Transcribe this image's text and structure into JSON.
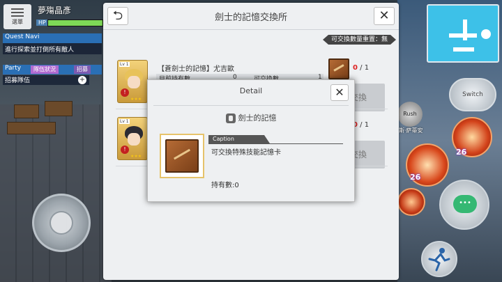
{
  "hud": {
    "menu_label": "選單",
    "player_name": "夢殤晶彥",
    "hp_label": "HP",
    "hp_fraction": 1.0,
    "quest_navi_label": "Quest Navi",
    "quest_text": "進行探索並打倒所有敵人",
    "party_label": "Party",
    "party_tab_1": "隊伍狀況",
    "party_tab_2": "招募",
    "party_row": "招募隊伍",
    "party_add": "+"
  },
  "panel": {
    "title": "劍士的記憶交換所",
    "back": "⮌",
    "close": "✕",
    "reset_badge": "可交換數量重置：無",
    "rows": [
      {
        "lv": "Lv 1",
        "name": "【蒼劍士的記憶】尤吉歐",
        "held_label": "目前持有數",
        "held_value": "0",
        "exchangeable_label": "可交換數",
        "exchangeable_value": "1",
        "count_have": "0",
        "count_total": "/ 1",
        "button": "交換",
        "hair_color": "#e8c25a"
      },
      {
        "lv": "Lv 1",
        "name": "",
        "held_label": "",
        "held_value": "",
        "exchangeable_label": "",
        "exchangeable_value": "",
        "count_have": "0",
        "count_total": "/ 1",
        "button": "交換",
        "hair_color": "#2b2b33"
      }
    ]
  },
  "detail": {
    "title": "Detail",
    "close": "✕",
    "subtitle": "劍士的記憶",
    "caption_label": "Caption",
    "caption_text": "可交換特殊技能記憶卡",
    "owned": "持有數:0"
  },
  "right_hud": {
    "switch_label": "Switch",
    "rush_label": "Rush",
    "rush_sub": "斯·萨蒂安",
    "skill_num_1": "26",
    "skill_num_2": "26",
    "chat_icon": "chat-bubble-icon",
    "dash_icon": "dash-runner-icon"
  }
}
